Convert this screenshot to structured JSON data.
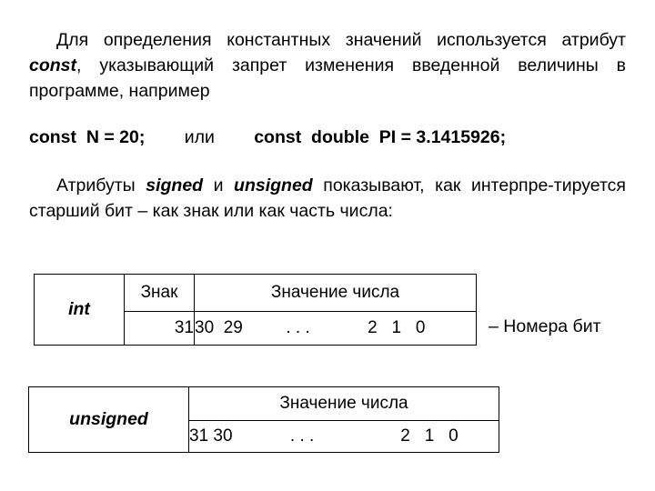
{
  "slide": {
    "paragraph_const": {
      "part1": "Для определения константных значений используется атрибут ",
      "keyword": "const",
      "part2": ", указывающий запрет изменения введенной величины в программе, например"
    },
    "code_line": {
      "statement1": "const  N = 20;",
      "separator": "или",
      "statement2": "const  double  PI = 3.1415926;",
      "gap1": "        ",
      "gap2": "        "
    },
    "paragraph_signed": {
      "part1": "Атрибуты ",
      "keyword1": "signed",
      "part2": " и ",
      "keyword2": "unsigned",
      "part3": " показывают, как интерпре-тируется старший  бит – как  знак  или  как часть числа:"
    },
    "table_int": {
      "type_label": "int",
      "header_sign": "Знак",
      "header_value": "Значение числа",
      "bit_sign": "31",
      "bits_value": "30  29         . . .            2   1   0"
    },
    "table_unsigned": {
      "type_label": "unsigned",
      "header_value": "Значение числа",
      "bits_value": "31 30            . . .                  2   1   0"
    },
    "bits_note": "– Номера бит"
  }
}
